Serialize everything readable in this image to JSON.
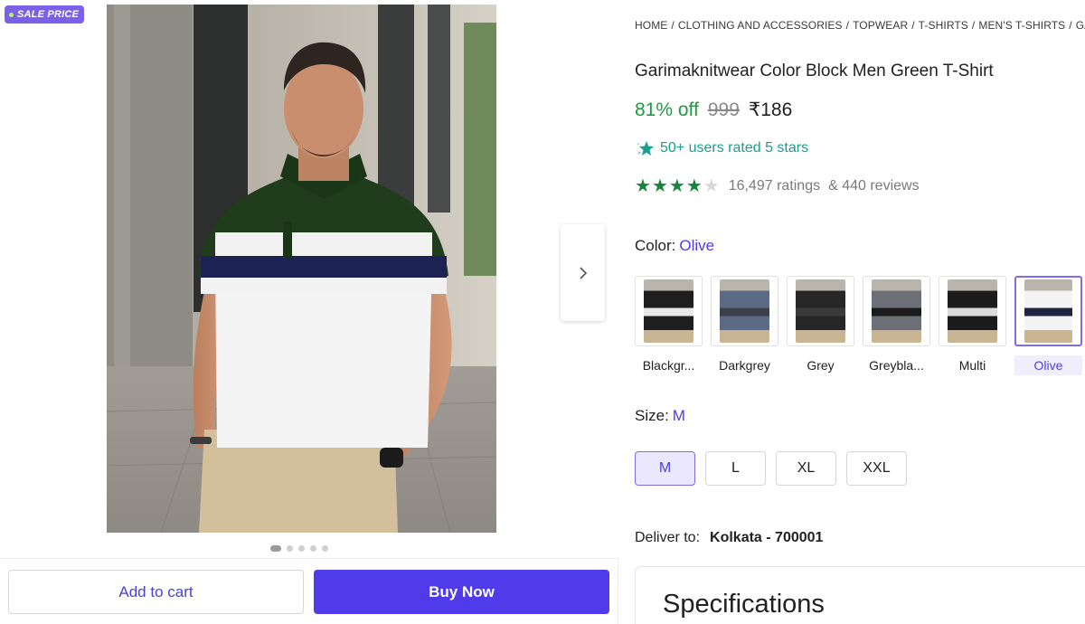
{
  "badge": {
    "label": "SALE PRICE"
  },
  "gallery": {
    "dot_count": 5,
    "active_index": 0
  },
  "actions": {
    "add_to_cart": "Add to cart",
    "buy_now": "Buy Now"
  },
  "breadcrumb": [
    "HOME",
    "CLOTHING AND ACCESSORIES",
    "TOPWEAR",
    "T-SHIRTS",
    "MEN'S T-SHIRTS",
    "GA"
  ],
  "product": {
    "title": "Garimaknitwear Color Block Men Green T-Shirt",
    "discount": "81% off",
    "mrp": "999",
    "price": "₹186",
    "rated_text": "50+ users rated 5 stars",
    "rating_value": 4,
    "ratings_count": "16,497 ratings",
    "reviews_count": "& 440 reviews"
  },
  "color": {
    "label": "Color:",
    "selected": "Olive",
    "options": [
      {
        "name": "Blackgr...",
        "shirt": "#1e1e1e",
        "band": "#e8e8e8"
      },
      {
        "name": "Darkgrey",
        "shirt": "#5d6a86",
        "band": "#3b3f4a"
      },
      {
        "name": "Grey",
        "shirt": "#262626",
        "band": "#3a3a3a"
      },
      {
        "name": "Greybla...",
        "shirt": "#6d6f76",
        "band": "#1a1a1a"
      },
      {
        "name": "Multi",
        "shirt": "#1b1b1b",
        "band": "#dcdcdc"
      },
      {
        "name": "Olive",
        "shirt": "#f4f4f4",
        "band": "#1e2340"
      }
    ]
  },
  "size": {
    "label": "Size:",
    "selected": "M",
    "options": [
      "M",
      "L",
      "XL",
      "XXL"
    ]
  },
  "delivery": {
    "label": "Deliver to:",
    "location": "Kolkata - 700001"
  },
  "specs": {
    "heading": "Specifications"
  },
  "colors": {
    "accent": "#4f3bea",
    "discount_green": "#1d9b3d",
    "teal": "#1a9e8f",
    "star_green": "#16843a"
  }
}
